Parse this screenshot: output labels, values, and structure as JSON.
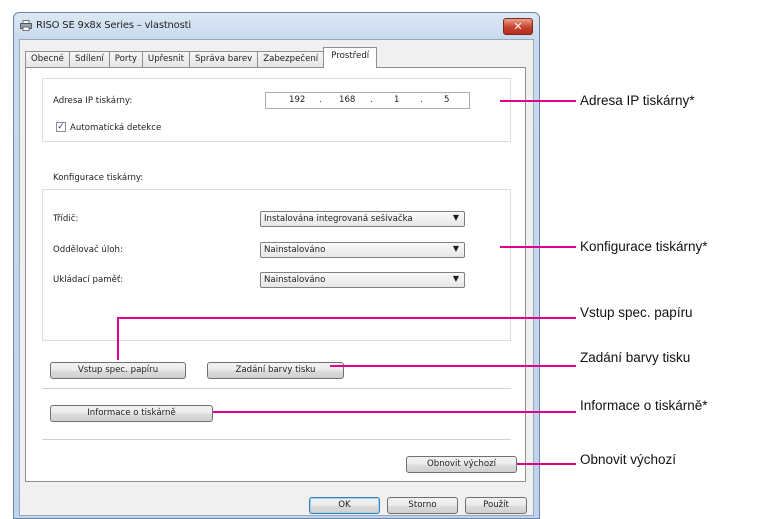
{
  "window": {
    "title": "RISO SE 9x8x Series – vlastnosti",
    "close_label": "✕"
  },
  "tabs": [
    "Obecné",
    "Sdílení",
    "Porty",
    "Upřesnit",
    "Správa barev",
    "Zabezpečení",
    "Prostředí"
  ],
  "active_tab": "Prostředí",
  "ip_section": {
    "label": "Adresa IP tiskárny:",
    "octets": [
      "192",
      ".",
      "168",
      ".",
      "1",
      ".",
      "5"
    ],
    "auto_detect_label": "Automatická detekce",
    "auto_detect_checked": true,
    "check_mark": "✓"
  },
  "config_section": {
    "label": "Konfigurace tiskárny:",
    "rows": [
      {
        "label": "Třídič:",
        "value": "Instalována integrovaná sešívačka"
      },
      {
        "label": "Oddělovač úloh:",
        "value": "Nainstalováno"
      },
      {
        "label": "Ukládací paměť:",
        "value": "Nainstalováno"
      }
    ],
    "dropdown_arrow": "▼"
  },
  "buttons": {
    "paper_input": "Vstup spec. papíru",
    "print_color": "Zadání barvy tisku",
    "printer_info": "Informace o tiskárně",
    "restore_default": "Obnovit výchozí",
    "ok": "OK",
    "cancel": "Storno",
    "apply": "Použít"
  },
  "callouts": {
    "ip": "Adresa IP tiskárny*",
    "config": "Konfigurace tiskárny*",
    "paper": "Vstup spec. papíru",
    "color": "Zadání barvy tisku",
    "info": "Informace o tiskárně*",
    "restore": "Obnovit výchozí"
  },
  "colors": {
    "callout_line": "#e0008c"
  }
}
